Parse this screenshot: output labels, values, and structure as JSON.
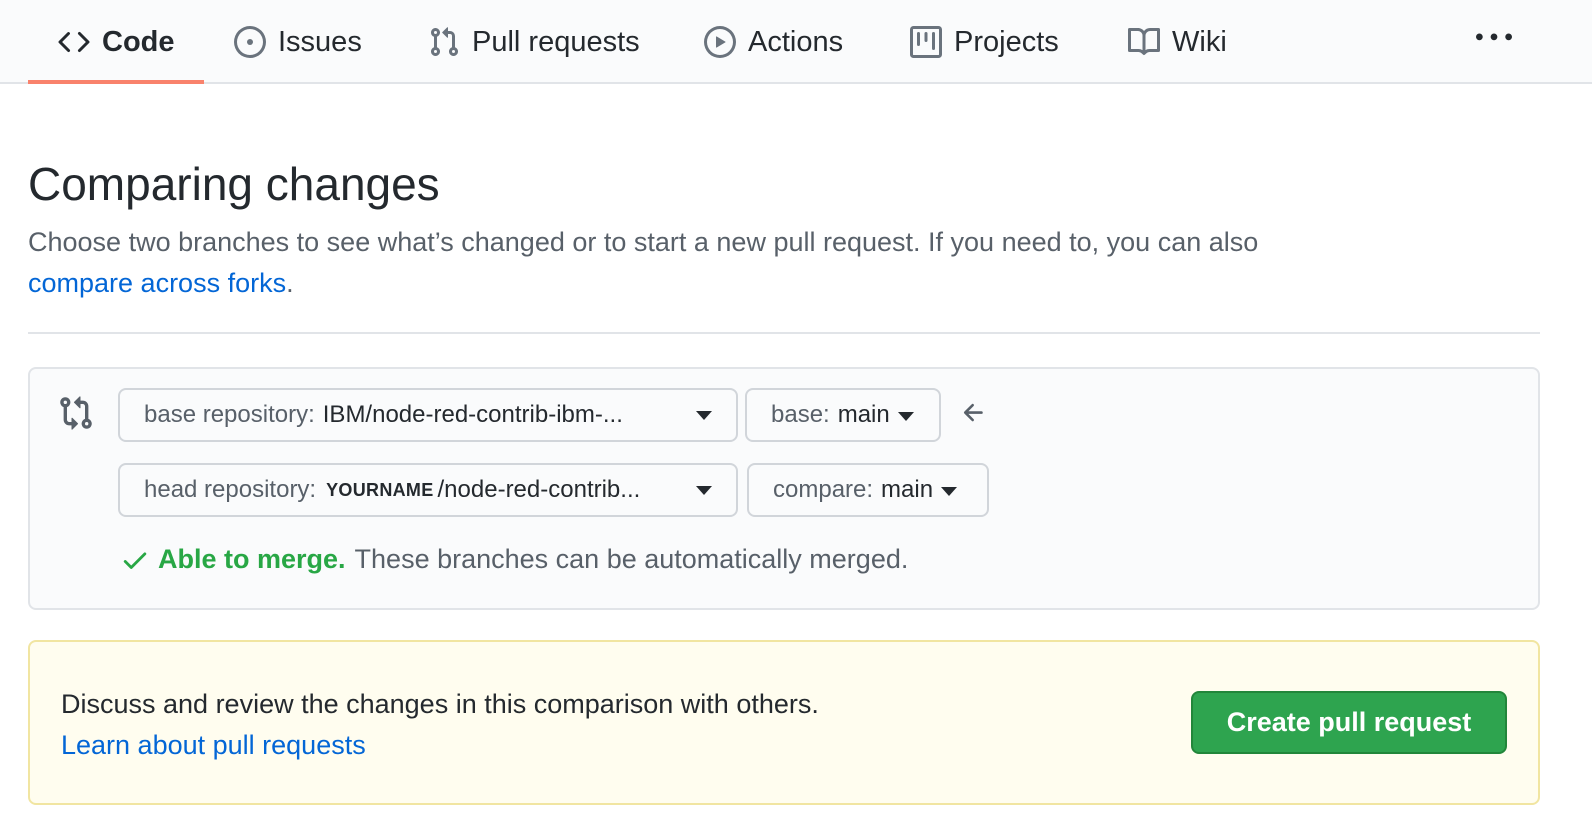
{
  "nav": {
    "tabs": [
      {
        "label": "Code",
        "icon": "code-icon",
        "active": true
      },
      {
        "label": "Issues",
        "icon": "issue-opened-icon",
        "active": false
      },
      {
        "label": "Pull requests",
        "icon": "git-pull-request-icon",
        "active": false
      },
      {
        "label": "Actions",
        "icon": "play-icon",
        "active": false
      },
      {
        "label": "Projects",
        "icon": "project-icon",
        "active": false
      },
      {
        "label": "Wiki",
        "icon": "book-icon",
        "active": false
      }
    ],
    "more_icon": "kebab-horizontal-icon",
    "active_underline_color": "#f9826c"
  },
  "header": {
    "title": "Comparing changes",
    "subtitle": "Choose two branches to see what’s changed or to start a new pull request. If you need to, you can also",
    "subtitle_link": "compare across forks",
    "subtitle_end": "."
  },
  "range": {
    "base_repo_label": "base repository:",
    "base_repo_value": "IBM/node-red-contrib-ibm-...",
    "base_branch_label": "base:",
    "base_branch_value": "main",
    "head_repo_label": "head repository:",
    "head_repo_owner": "YOURNAME",
    "head_repo_value": "/node-red-contrib...",
    "compare_branch_label": "compare:",
    "compare_branch_value": "main",
    "merge_ok": "Able to merge.",
    "merge_message": "These branches can be automatically merged.",
    "merge_ok_color": "#28a745"
  },
  "flash": {
    "message": "Discuss and review the changes in this comparison with others.",
    "link": "Learn about pull requests",
    "button": "Create pull request",
    "button_color": "#2ea44f"
  }
}
